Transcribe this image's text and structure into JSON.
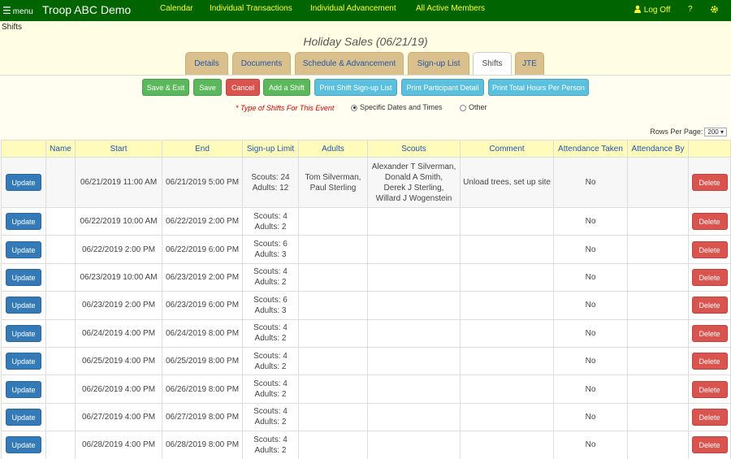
{
  "topbar": {
    "menu_label": "menu",
    "troop_title": "Troop ABC Demo",
    "nav": [
      "Calendar",
      "Individual Transactions",
      "Individual Advancement",
      "All Active Members"
    ],
    "logoff": "Log Off",
    "help": "?",
    "colors": {
      "bar": "#006400",
      "link": "#ffff33"
    }
  },
  "breadcrumb": "Shifts",
  "event_title": "Holiday Sales (06/21/19)",
  "tabs": [
    "Details",
    "Documents",
    "Schedule & Advancement",
    "Sign-up List",
    "Shifts",
    "JTE"
  ],
  "active_tab": "Shifts",
  "actions": {
    "save_exit": "Save & Exit",
    "save": "Save",
    "cancel": "Cancel",
    "add_shift": "Add a Shift",
    "print_signup": "Print Shift Sign-up List",
    "print_participant": "Print Participant Detail",
    "print_total": "Print Total Hours Per Person"
  },
  "shift_type": {
    "required_mark": "*",
    "label": "Type of Shifts For This Event",
    "options": [
      "Specific Dates and Times",
      "Other"
    ],
    "selected": "Specific Dates and Times"
  },
  "rows_per_page": {
    "label": "Rows Per Page:",
    "value": "200"
  },
  "table": {
    "headers": [
      "",
      "Name",
      "Start",
      "End",
      "Sign-up Limit",
      "Adults",
      "Scouts",
      "Comment",
      "Attendance Taken",
      "Attendance By",
      ""
    ],
    "update_label": "Update",
    "delete_label": "Delete",
    "rows": [
      {
        "start": "06/21/2019 11:00 AM",
        "end": "06/21/2019 5:00 PM",
        "limit": [
          "Scouts: 24",
          "Adults: 12"
        ],
        "adults": [
          "Tom Silverman,",
          "Paul Sterling"
        ],
        "scouts": [
          "Alexander T Silverman,",
          "Donald A Smith,",
          "Derek J Sterling,",
          "Willard J Wogenstein"
        ],
        "comment": "Unload trees, set up site",
        "attendance": "No"
      },
      {
        "start": "06/22/2019 10:00 AM",
        "end": "06/22/2019 2:00 PM",
        "limit": [
          "Scouts: 4",
          "Adults: 2"
        ],
        "adults": [],
        "scouts": [],
        "comment": "",
        "attendance": "No"
      },
      {
        "start": "06/22/2019 2:00 PM",
        "end": "06/22/2019 6:00 PM",
        "limit": [
          "Scouts: 6",
          "Adults: 3"
        ],
        "adults": [],
        "scouts": [],
        "comment": "",
        "attendance": "No"
      },
      {
        "start": "06/23/2019 10:00 AM",
        "end": "06/23/2019 2:00 PM",
        "limit": [
          "Scouts: 4",
          "Adults: 2"
        ],
        "adults": [],
        "scouts": [],
        "comment": "",
        "attendance": "No"
      },
      {
        "start": "06/23/2019 2:00 PM",
        "end": "06/23/2019 6:00 PM",
        "limit": [
          "Scouts: 6",
          "Adults: 3"
        ],
        "adults": [],
        "scouts": [],
        "comment": "",
        "attendance": "No"
      },
      {
        "start": "06/24/2019 4:00 PM",
        "end": "06/24/2019 8:00 PM",
        "limit": [
          "Scouts: 4",
          "Adults: 2"
        ],
        "adults": [],
        "scouts": [],
        "comment": "",
        "attendance": "No"
      },
      {
        "start": "06/25/2019 4:00 PM",
        "end": "06/25/2019 8:00 PM",
        "limit": [
          "Scouts: 4",
          "Adults: 2"
        ],
        "adults": [],
        "scouts": [],
        "comment": "",
        "attendance": "No"
      },
      {
        "start": "06/26/2019 4:00 PM",
        "end": "06/26/2019 8:00 PM",
        "limit": [
          "Scouts: 4",
          "Adults: 2"
        ],
        "adults": [],
        "scouts": [],
        "comment": "",
        "attendance": "No"
      },
      {
        "start": "06/27/2019 4:00 PM",
        "end": "06/27/2019 8:00 PM",
        "limit": [
          "Scouts: 4",
          "Adults: 2"
        ],
        "adults": [],
        "scouts": [],
        "comment": "",
        "attendance": "No"
      },
      {
        "start": "06/28/2019 4:00 PM",
        "end": "06/28/2019 8:00 PM",
        "limit": [
          "Scouts: 4",
          "Adults: 2"
        ],
        "adults": [],
        "scouts": [],
        "comment": "",
        "attendance": "No"
      }
    ]
  }
}
